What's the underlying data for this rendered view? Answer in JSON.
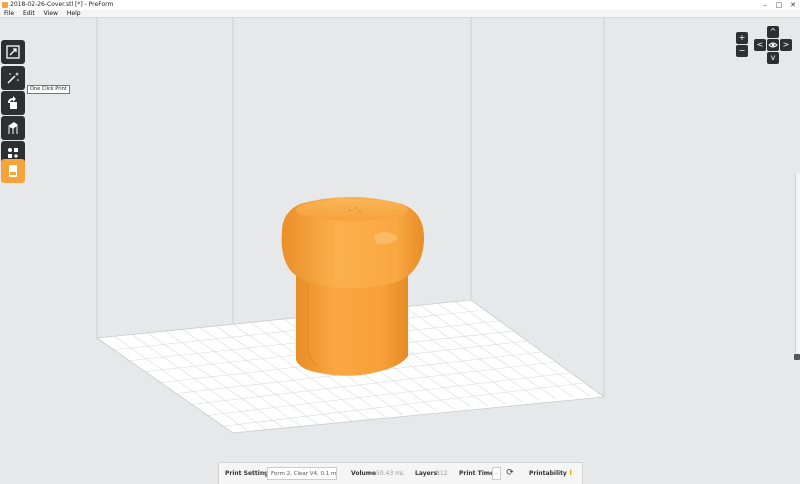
{
  "window": {
    "title": "2018-02-26-Cover.stl [*] - PreForm",
    "controls": [
      "–",
      "□",
      "✕"
    ]
  },
  "menu": [
    "File",
    "Edit",
    "View",
    "Help"
  ],
  "toolbar": {
    "tools": [
      {
        "name": "fit-view",
        "icon": "expand-icon"
      },
      {
        "name": "one-click-print",
        "icon": "magic-wand-icon"
      },
      {
        "name": "orientation",
        "icon": "rotate-icon"
      },
      {
        "name": "supports",
        "icon": "supports-icon"
      },
      {
        "name": "layout",
        "icon": "layout-icon"
      },
      {
        "name": "job-summary",
        "icon": "printer-icon"
      }
    ],
    "tooltip": "One Click Print",
    "active_color": "#f7a33c"
  },
  "nav": {
    "zoom_in": "+",
    "zoom_out": "−",
    "up": "^",
    "down": "v",
    "left": "<",
    "right": ">"
  },
  "status": {
    "print_settings_label": "Print Settings",
    "print_settings_value": "Form 2, Clear V4, 0.1 mm",
    "volume_label": "Volume",
    "volume_value": "50.43 mL",
    "layers_label": "Layers",
    "layers_value": "812",
    "print_time_label": "Print Time",
    "print_time_value": "--",
    "printability_label": "Printability",
    "printability_value": "!"
  },
  "colors": {
    "model": "#f7a33c",
    "toolbar_bg": "#2d2f32",
    "viewport_bg": "#e7e8ea"
  }
}
